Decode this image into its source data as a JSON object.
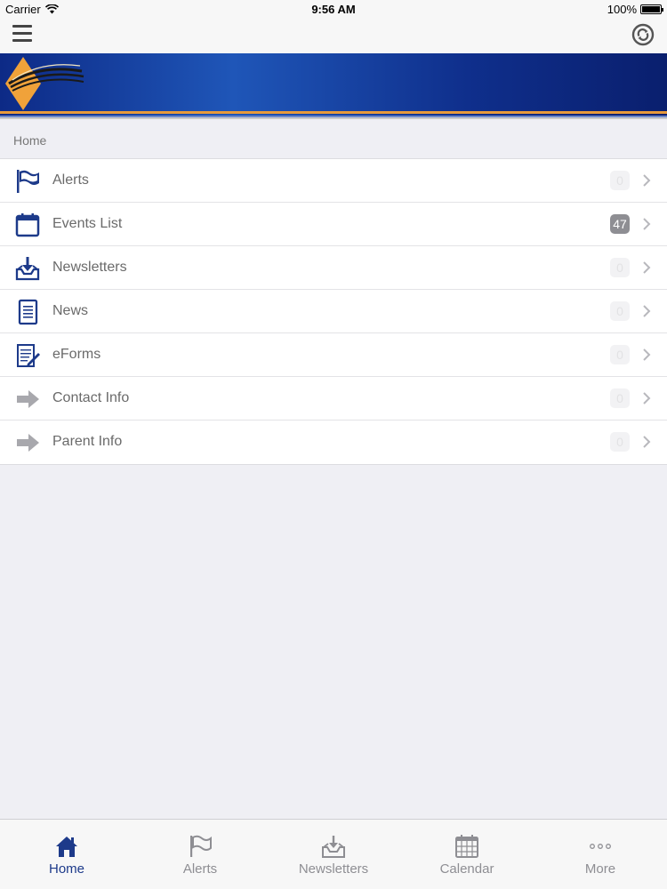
{
  "status_bar": {
    "carrier": "Carrier",
    "time": "9:56 AM",
    "battery": "100%"
  },
  "breadcrumb": "Home",
  "menu_items": [
    {
      "label": "Alerts",
      "badge": "0",
      "icon": "flag-icon"
    },
    {
      "label": "Events List",
      "badge": "47",
      "icon": "calendar-icon"
    },
    {
      "label": "Newsletters",
      "badge": "0",
      "icon": "inbox-download-icon"
    },
    {
      "label": "News",
      "badge": "0",
      "icon": "document-icon"
    },
    {
      "label": "eForms",
      "badge": "0",
      "icon": "form-pencil-icon"
    },
    {
      "label": "Contact Info",
      "badge": "0",
      "icon": "arrow-right-icon"
    },
    {
      "label": "Parent Info",
      "badge": "0",
      "icon": "arrow-right-icon"
    }
  ],
  "tabs": [
    {
      "label": "Home",
      "icon": "home-icon",
      "active": true
    },
    {
      "label": "Alerts",
      "icon": "flag-icon",
      "active": false
    },
    {
      "label": "Newsletters",
      "icon": "inbox-download-icon",
      "active": false
    },
    {
      "label": "Calendar",
      "icon": "calendar-grid-icon",
      "active": false
    },
    {
      "label": "More",
      "icon": "more-dots-icon",
      "active": false
    }
  ],
  "colors": {
    "brand_blue": "#1d3a8a",
    "banner_orange": "#e89a3a",
    "badge_active": "#8e8e93"
  }
}
